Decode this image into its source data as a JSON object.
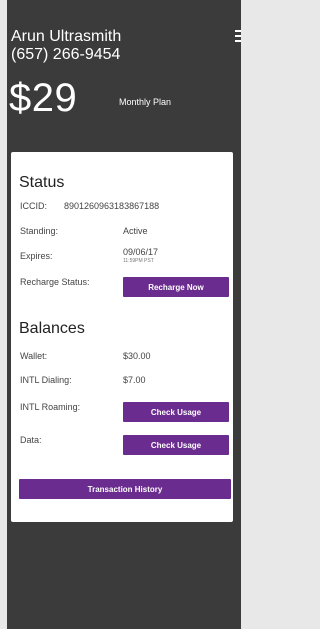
{
  "header": {
    "name": "Arun Ultrasmith",
    "phone": "(657) 266-9454",
    "menu_icon": "hamburger-menu-icon"
  },
  "plan": {
    "price": "$29",
    "label": "Monthly Plan"
  },
  "status": {
    "title": "Status",
    "iccid_label": "ICCID:",
    "iccid_value": "8901260963183867188",
    "standing_label": "Standing:",
    "standing_value": "Active",
    "expires_label": "Expires:",
    "expires_value": "09/06/17",
    "expires_time": "11:59PM PST",
    "recharge_label": "Recharge Status:",
    "recharge_button": "Recharge Now"
  },
  "balances": {
    "title": "Balances",
    "wallet_label": "Wallet:",
    "wallet_value": "$30.00",
    "intl_dialing_label": "INTL Dialing:",
    "intl_dialing_value": "$7.00",
    "intl_roaming_label": "INTL Roaming:",
    "intl_roaming_button": "Check Usage",
    "data_label": "Data:",
    "data_button": "Check Usage"
  },
  "transaction_history_button": "Transaction History",
  "colors": {
    "accent": "#6a2c8e",
    "header_bg": "#3b3b3b",
    "card_bg": "#ffffff"
  }
}
